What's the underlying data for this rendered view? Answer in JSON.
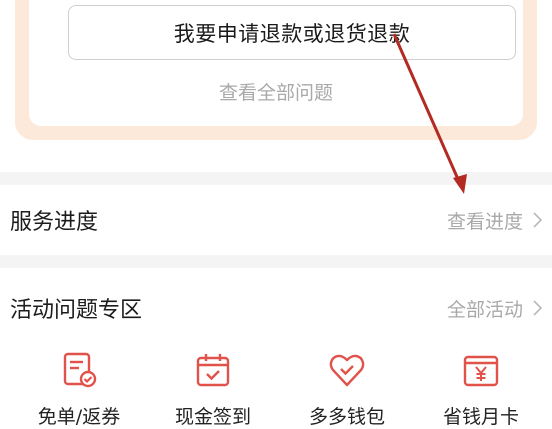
{
  "help_card": {
    "refund_button_label": "我要申请退款或退货退款",
    "view_all_issues": "查看全部问题"
  },
  "service_progress": {
    "title": "服务进度",
    "link": "查看进度"
  },
  "activity_section": {
    "title": "活动问题专区",
    "link": "全部活动",
    "items": [
      {
        "label": "免单/返券",
        "icon": "coupon-check-icon"
      },
      {
        "label": "现金签到",
        "icon": "calendar-check-icon"
      },
      {
        "label": "多多钱包",
        "icon": "heart-wallet-icon"
      },
      {
        "label": "省钱月卡",
        "icon": "yen-card-icon"
      }
    ]
  },
  "colors": {
    "card_border": "#fde9d9",
    "icon_red": "#e0524a",
    "annotation_arrow": "#b22a22"
  }
}
